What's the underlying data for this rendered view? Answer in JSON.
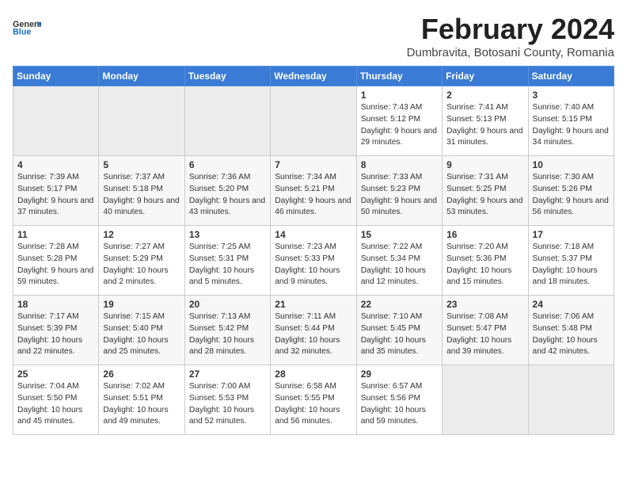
{
  "header": {
    "logo_line1": "General",
    "logo_line2": "Blue",
    "month_year": "February 2024",
    "location": "Dumbravita, Botosani County, Romania"
  },
  "days_of_week": [
    "Sunday",
    "Monday",
    "Tuesday",
    "Wednesday",
    "Thursday",
    "Friday",
    "Saturday"
  ],
  "weeks": [
    [
      {
        "day": "",
        "empty": true
      },
      {
        "day": "",
        "empty": true
      },
      {
        "day": "",
        "empty": true
      },
      {
        "day": "",
        "empty": true
      },
      {
        "day": "1",
        "sunrise": "7:43 AM",
        "sunset": "5:12 PM",
        "daylight": "9 hours and 29 minutes."
      },
      {
        "day": "2",
        "sunrise": "7:41 AM",
        "sunset": "5:13 PM",
        "daylight": "9 hours and 31 minutes."
      },
      {
        "day": "3",
        "sunrise": "7:40 AM",
        "sunset": "5:15 PM",
        "daylight": "9 hours and 34 minutes."
      }
    ],
    [
      {
        "day": "4",
        "sunrise": "7:39 AM",
        "sunset": "5:17 PM",
        "daylight": "9 hours and 37 minutes."
      },
      {
        "day": "5",
        "sunrise": "7:37 AM",
        "sunset": "5:18 PM",
        "daylight": "9 hours and 40 minutes."
      },
      {
        "day": "6",
        "sunrise": "7:36 AM",
        "sunset": "5:20 PM",
        "daylight": "9 hours and 43 minutes."
      },
      {
        "day": "7",
        "sunrise": "7:34 AM",
        "sunset": "5:21 PM",
        "daylight": "9 hours and 46 minutes."
      },
      {
        "day": "8",
        "sunrise": "7:33 AM",
        "sunset": "5:23 PM",
        "daylight": "9 hours and 50 minutes."
      },
      {
        "day": "9",
        "sunrise": "7:31 AM",
        "sunset": "5:25 PM",
        "daylight": "9 hours and 53 minutes."
      },
      {
        "day": "10",
        "sunrise": "7:30 AM",
        "sunset": "5:26 PM",
        "daylight": "9 hours and 56 minutes."
      }
    ],
    [
      {
        "day": "11",
        "sunrise": "7:28 AM",
        "sunset": "5:28 PM",
        "daylight": "9 hours and 59 minutes."
      },
      {
        "day": "12",
        "sunrise": "7:27 AM",
        "sunset": "5:29 PM",
        "daylight": "10 hours and 2 minutes."
      },
      {
        "day": "13",
        "sunrise": "7:25 AM",
        "sunset": "5:31 PM",
        "daylight": "10 hours and 5 minutes."
      },
      {
        "day": "14",
        "sunrise": "7:23 AM",
        "sunset": "5:33 PM",
        "daylight": "10 hours and 9 minutes."
      },
      {
        "day": "15",
        "sunrise": "7:22 AM",
        "sunset": "5:34 PM",
        "daylight": "10 hours and 12 minutes."
      },
      {
        "day": "16",
        "sunrise": "7:20 AM",
        "sunset": "5:36 PM",
        "daylight": "10 hours and 15 minutes."
      },
      {
        "day": "17",
        "sunrise": "7:18 AM",
        "sunset": "5:37 PM",
        "daylight": "10 hours and 18 minutes."
      }
    ],
    [
      {
        "day": "18",
        "sunrise": "7:17 AM",
        "sunset": "5:39 PM",
        "daylight": "10 hours and 22 minutes."
      },
      {
        "day": "19",
        "sunrise": "7:15 AM",
        "sunset": "5:40 PM",
        "daylight": "10 hours and 25 minutes."
      },
      {
        "day": "20",
        "sunrise": "7:13 AM",
        "sunset": "5:42 PM",
        "daylight": "10 hours and 28 minutes."
      },
      {
        "day": "21",
        "sunrise": "7:11 AM",
        "sunset": "5:44 PM",
        "daylight": "10 hours and 32 minutes."
      },
      {
        "day": "22",
        "sunrise": "7:10 AM",
        "sunset": "5:45 PM",
        "daylight": "10 hours and 35 minutes."
      },
      {
        "day": "23",
        "sunrise": "7:08 AM",
        "sunset": "5:47 PM",
        "daylight": "10 hours and 39 minutes."
      },
      {
        "day": "24",
        "sunrise": "7:06 AM",
        "sunset": "5:48 PM",
        "daylight": "10 hours and 42 minutes."
      }
    ],
    [
      {
        "day": "25",
        "sunrise": "7:04 AM",
        "sunset": "5:50 PM",
        "daylight": "10 hours and 45 minutes."
      },
      {
        "day": "26",
        "sunrise": "7:02 AM",
        "sunset": "5:51 PM",
        "daylight": "10 hours and 49 minutes."
      },
      {
        "day": "27",
        "sunrise": "7:00 AM",
        "sunset": "5:53 PM",
        "daylight": "10 hours and 52 minutes."
      },
      {
        "day": "28",
        "sunrise": "6:58 AM",
        "sunset": "5:55 PM",
        "daylight": "10 hours and 56 minutes."
      },
      {
        "day": "29",
        "sunrise": "6:57 AM",
        "sunset": "5:56 PM",
        "daylight": "10 hours and 59 minutes."
      },
      {
        "day": "",
        "empty": true
      },
      {
        "day": "",
        "empty": true
      }
    ]
  ],
  "labels": {
    "sunrise": "Sunrise:",
    "sunset": "Sunset:",
    "daylight": "Daylight:"
  }
}
